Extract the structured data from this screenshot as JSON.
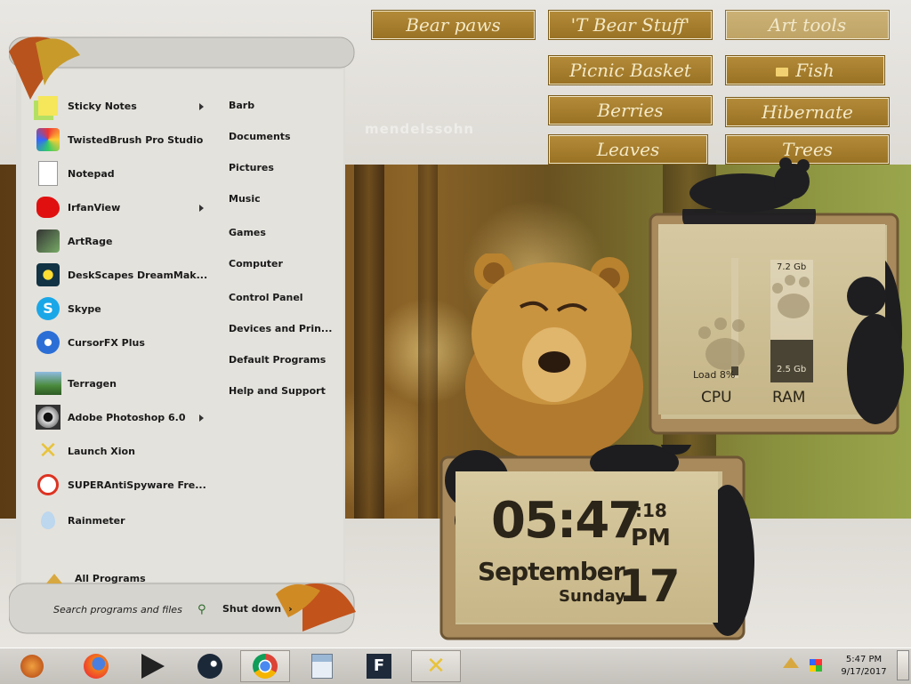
{
  "wallpaper": {
    "watermark": "mendelssohn"
  },
  "folders": [
    {
      "label": "Bear paws",
      "style": "dark"
    },
    {
      "label": "'T Bear Stuff'",
      "style": "dark"
    },
    {
      "label": "Art tools",
      "style": "light"
    },
    {
      "label": "Picnic Basket",
      "style": "dark"
    },
    {
      "label": "Fish",
      "style": "dark",
      "icon": "folder-icon"
    },
    {
      "label": "Berries",
      "style": "dark"
    },
    {
      "label": "Hibernate",
      "style": "dark"
    },
    {
      "label": "Leaves",
      "style": "dark"
    },
    {
      "label": "Trees",
      "style": "dark"
    }
  ],
  "start_menu": {
    "programs": [
      {
        "label": "Sticky Notes",
        "icon": "sticky-notes-icon",
        "submenu": true
      },
      {
        "label": "TwistedBrush Pro Studio",
        "icon": "twistedbrush-icon",
        "submenu": false
      },
      {
        "label": "Notepad",
        "icon": "notepad-icon",
        "submenu": false
      },
      {
        "label": "IrfanView",
        "icon": "irfanview-icon",
        "submenu": true
      },
      {
        "label": "ArtRage",
        "icon": "artrage-icon",
        "submenu": false
      },
      {
        "label": "DeskScapes DreamMak...",
        "icon": "deskscapes-icon",
        "submenu": false
      },
      {
        "label": "Skype",
        "icon": "skype-icon",
        "submenu": false
      },
      {
        "label": "CursorFX Plus",
        "icon": "cursorfx-icon",
        "submenu": false
      },
      {
        "label": "Terragen",
        "icon": "terragen-icon",
        "submenu": false
      },
      {
        "label": "Adobe Photoshop 6.0",
        "icon": "photoshop-icon",
        "submenu": true
      },
      {
        "label": "Launch Xion",
        "icon": "xion-icon",
        "submenu": false
      },
      {
        "label": "SUPERAntiSpyware Fre...",
        "icon": "superantispyware-icon",
        "submenu": false
      },
      {
        "label": "Rainmeter",
        "icon": "rainmeter-icon",
        "submenu": false
      }
    ],
    "places": [
      "Barb",
      "Documents",
      "Pictures",
      "Music",
      "Games",
      "Computer",
      "Control Panel",
      "Devices and Prin...",
      "Default Programs",
      "Help and Support"
    ],
    "all_programs": "All Programs",
    "search_placeholder": "Search programs and files",
    "shutdown": "Shut down"
  },
  "gauges": {
    "cpu_label": "CPU",
    "cpu_load": "Load 8%",
    "cpu_load_fraction": 0.08,
    "ram_label": "RAM",
    "ram_total": "7.2 Gb",
    "ram_used": "2.5 Gb",
    "ram_fraction": 0.35
  },
  "clock": {
    "time": "05:47",
    "seconds": ":18",
    "ampm": "PM",
    "month": "September",
    "weekday": "Sunday",
    "day": "17"
  },
  "taskbar": {
    "apps": [
      {
        "name": "orb-start-button",
        "icon": "windows-orb-icon"
      },
      {
        "name": "firefox",
        "icon": "firefox-icon"
      },
      {
        "name": "inkscape",
        "icon": "inkscape-icon"
      },
      {
        "name": "steam",
        "icon": "steam-icon"
      },
      {
        "name": "chrome",
        "icon": "chrome-icon"
      },
      {
        "name": "calculator",
        "icon": "calculator-icon"
      },
      {
        "name": "rainmeter-app",
        "icon": "app-f-icon"
      },
      {
        "name": "xion",
        "icon": "xion-icon"
      }
    ],
    "time": "5:47 PM",
    "date": "9/17/2017"
  }
}
